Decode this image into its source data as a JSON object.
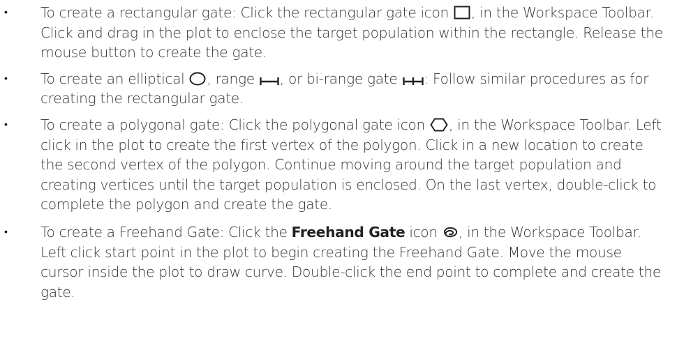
{
  "bullets": [
    {
      "segments": {
        "a": "To create a rectangular gate: Click the rectangular gate icon ",
        "b": ", in the Workspace Toolbar. Click and drag in the plot to enclose the target population within the rectangle. Release the mouse button to create the gate."
      },
      "icons": [
        "rectangle-gate-icon"
      ]
    },
    {
      "segments": {
        "a": "To create an elliptical ",
        "b": ", range ",
        "c": ", or bi-range gate ",
        "d": ": Follow similar procedures as for creating the rectangular gate."
      },
      "icons": [
        "ellipse-gate-icon",
        "range-gate-icon",
        "bi-range-gate-icon"
      ]
    },
    {
      "segments": {
        "a": "To create a polygonal gate: Click the polygonal gate icon ",
        "b": ", in the Workspace Toolbar. Left click in the plot to create the first vertex of the polygon. Click in a new location to create the second vertex of the polygon. Continue moving around the target population and creating vertices until the target population is enclosed. On the last vertex, double-click to complete the polygon and create the gate."
      },
      "icons": [
        "polygon-gate-icon"
      ]
    },
    {
      "segments": {
        "a": "To create a Freehand Gate: Click the ",
        "bold": "Freehand Gate",
        "b": " icon ",
        "c": ", in the Workspace Toolbar. Left click start point in the plot to begin creating the Freehand Gate. Move the mouse cursor inside the plot to draw curve. Double-click the end point to complete and create the gate."
      },
      "icons": [
        "freehand-gate-icon"
      ]
    }
  ],
  "bullet_symbol": "•",
  "colors": {
    "text": "#333333",
    "icon_stroke": "#222222"
  }
}
